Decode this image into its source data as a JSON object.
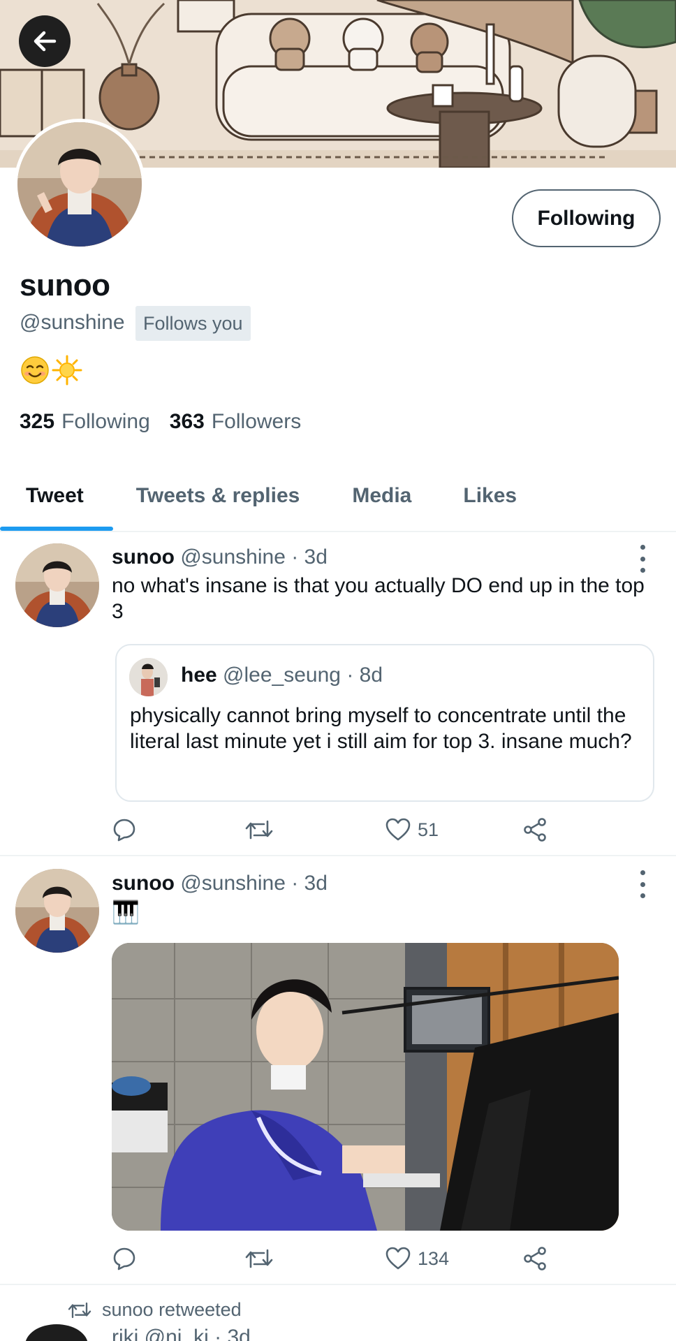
{
  "header": {
    "back_icon": "arrow-left-icon"
  },
  "profile": {
    "name": "sunoo",
    "handle": "@sunshine",
    "follows_you": "Follows you",
    "follow_button": "Following",
    "bio_emojis": [
      "smiling-face-icon",
      "sun-icon"
    ],
    "following_count": "325",
    "following_label": "Following",
    "followers_count": "363",
    "followers_label": "Followers"
  },
  "tabs": [
    {
      "label": "Tweet",
      "active": true
    },
    {
      "label": "Tweets & replies",
      "active": false
    },
    {
      "label": "Media",
      "active": false
    },
    {
      "label": "Likes",
      "active": false
    }
  ],
  "tweets": [
    {
      "name": "sunoo",
      "handle": "@sunshine",
      "time": "· 3d",
      "text": "no what's insane is that you actually DO end up in the top 3",
      "quote": {
        "name": "hee",
        "handle": "@lee_seung",
        "time": "· 8d",
        "text": "physically cannot bring myself to concentrate until the literal last minute yet i still aim for top 3. insane much?"
      },
      "likes": "51"
    },
    {
      "name": "sunoo",
      "handle": "@sunshine",
      "time": "· 3d",
      "text": "🎹",
      "media": "piano-photo",
      "likes": "134"
    }
  ],
  "retweet": {
    "label": "sunoo retweeted",
    "peek": "riki @ni_ki · 3d"
  },
  "colors": {
    "accent": "#1d9bf0",
    "muted": "#536471",
    "text": "#0f1419"
  }
}
